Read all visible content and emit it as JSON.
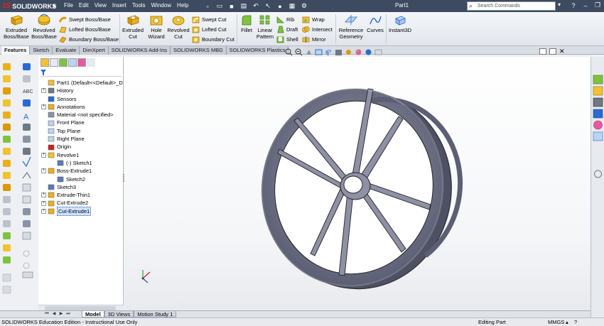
{
  "app": {
    "brand_ds": "3S",
    "brand_name": "SOLIDWORKS",
    "document_title": "Part1"
  },
  "menu": [
    "File",
    "Edit",
    "View",
    "Insert",
    "Tools",
    "Window",
    "Help"
  ],
  "search": {
    "placeholder": "Search Commands"
  },
  "ribbon": {
    "extruded_boss": "Extruded Boss/Base",
    "revolved_boss": "Revolved Boss/Base",
    "swept_boss": "Swept Boss/Base",
    "lofted_boss": "Lofted Boss/Base",
    "boundary_boss": "Boundary Boss/Base",
    "extruded_cut": "Extruded Cut",
    "hole_wizard": "Hole Wizard",
    "revolved_cut": "Revolved Cut",
    "swept_cut": "Swept Cut",
    "lofted_cut": "Lofted Cut",
    "boundary_cut": "Boundary Cut",
    "fillet": "Fillet",
    "linear_pattern": "Linear Pattern",
    "rib": "Rib",
    "draft": "Draft",
    "shell": "Shell",
    "wrap": "Wrap",
    "intersect": "Intersect",
    "mirror": "Mirror",
    "reference_geometry": "Reference Geometry",
    "curves": "Curves",
    "instant3d": "Instant3D"
  },
  "command_tabs": [
    "Features",
    "Sketch",
    "Evaluate",
    "DimXpert",
    "SOLIDWORKS Add-Ins",
    "SOLIDWORKS MBD",
    "SOLIDWORKS Plastics"
  ],
  "tree": [
    {
      "label": "Part1  (Default<<Default>_D",
      "expand": false,
      "icon": "part-icon"
    },
    {
      "label": "History",
      "expand": true,
      "icon": "history-icon"
    },
    {
      "label": "Sensors",
      "expand": false,
      "icon": "sensor-icon"
    },
    {
      "label": "Annotations",
      "expand": true,
      "icon": "annotation-icon"
    },
    {
      "label": "Material <not specified>",
      "expand": false,
      "icon": "material-icon"
    },
    {
      "label": "Front Plane",
      "expand": false,
      "icon": "plane-icon"
    },
    {
      "label": "Top Plane",
      "expand": false,
      "icon": "plane-icon"
    },
    {
      "label": "Right Plane",
      "expand": false,
      "icon": "plane-icon"
    },
    {
      "label": "Origin",
      "expand": false,
      "icon": "origin-icon"
    },
    {
      "label": "Revolve1",
      "expand": true,
      "icon": "revolve-icon"
    },
    {
      "label": "(-) Sketch1",
      "expand": false,
      "icon": "sketch-icon",
      "indent": true
    },
    {
      "label": "Boss-Extrude1",
      "expand": true,
      "icon": "extrude-icon"
    },
    {
      "label": "Sketch2",
      "expand": false,
      "icon": "sketch-icon",
      "indent": true
    },
    {
      "label": "Sketch3",
      "expand": false,
      "icon": "sketch-icon"
    },
    {
      "label": "Extrude-Thin1",
      "expand": true,
      "icon": "extrude-icon"
    },
    {
      "label": "Cut-Extrude2",
      "expand": true,
      "icon": "cut-icon"
    },
    {
      "label": "Cut-Extrude1",
      "expand": true,
      "icon": "cut-icon",
      "selected": true
    }
  ],
  "bottom_tabs": [
    "Model",
    "3D Views",
    "Motion Study 1"
  ],
  "status": {
    "left": "SOLIDWORKS Education Edition - Instructional Use Only",
    "mode": "Editing Part",
    "units": "MMGS",
    "arrow": "▴"
  },
  "colors": {
    "titlebar": "#3d4a60",
    "wheel": "#7c7f96",
    "selection": "#cfe3ff"
  }
}
